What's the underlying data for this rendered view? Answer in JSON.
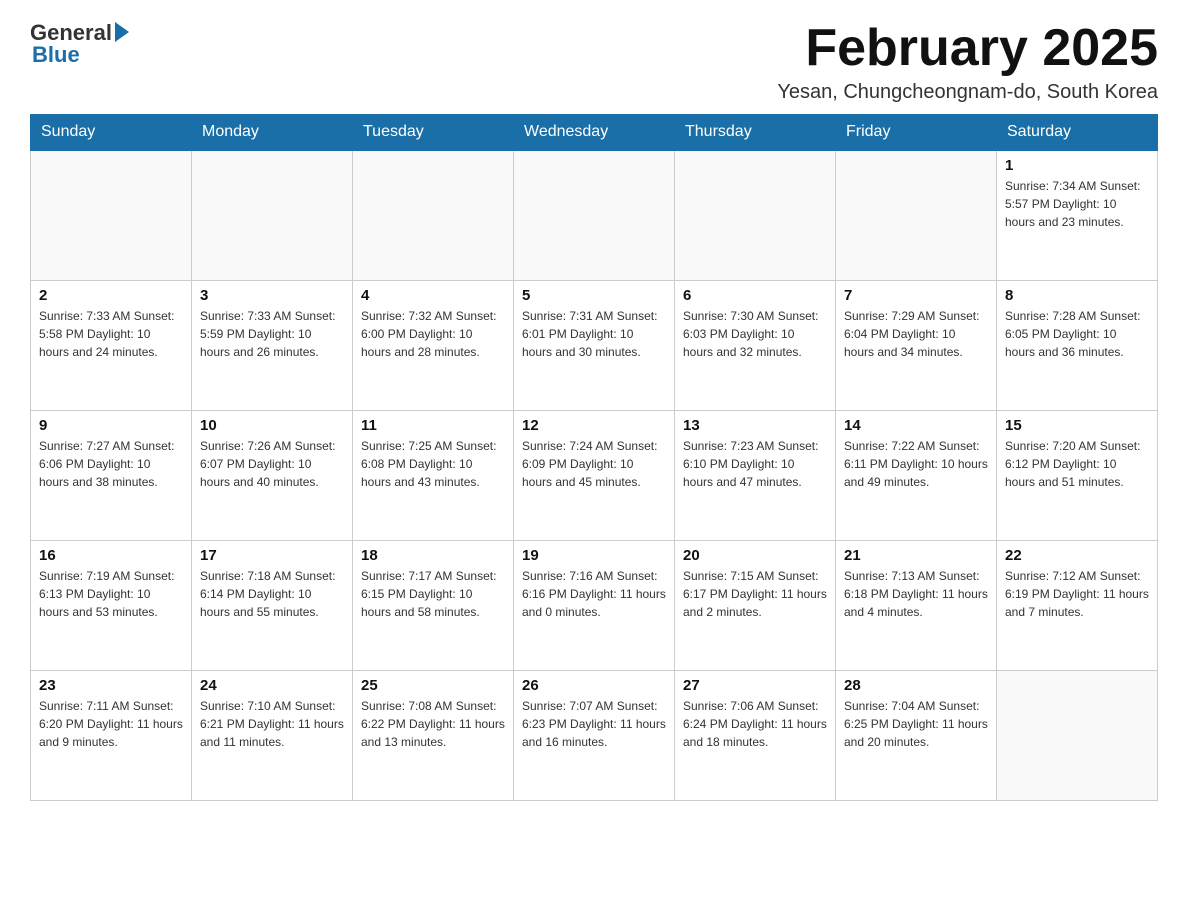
{
  "header": {
    "logo_general": "General",
    "logo_blue": "Blue",
    "month_title": "February 2025",
    "location": "Yesan, Chungcheongnam-do, South Korea"
  },
  "days_of_week": [
    "Sunday",
    "Monday",
    "Tuesday",
    "Wednesday",
    "Thursday",
    "Friday",
    "Saturday"
  ],
  "weeks": [
    [
      {
        "day": "",
        "info": ""
      },
      {
        "day": "",
        "info": ""
      },
      {
        "day": "",
        "info": ""
      },
      {
        "day": "",
        "info": ""
      },
      {
        "day": "",
        "info": ""
      },
      {
        "day": "",
        "info": ""
      },
      {
        "day": "1",
        "info": "Sunrise: 7:34 AM\nSunset: 5:57 PM\nDaylight: 10 hours and 23 minutes."
      }
    ],
    [
      {
        "day": "2",
        "info": "Sunrise: 7:33 AM\nSunset: 5:58 PM\nDaylight: 10 hours and 24 minutes."
      },
      {
        "day": "3",
        "info": "Sunrise: 7:33 AM\nSunset: 5:59 PM\nDaylight: 10 hours and 26 minutes."
      },
      {
        "day": "4",
        "info": "Sunrise: 7:32 AM\nSunset: 6:00 PM\nDaylight: 10 hours and 28 minutes."
      },
      {
        "day": "5",
        "info": "Sunrise: 7:31 AM\nSunset: 6:01 PM\nDaylight: 10 hours and 30 minutes."
      },
      {
        "day": "6",
        "info": "Sunrise: 7:30 AM\nSunset: 6:03 PM\nDaylight: 10 hours and 32 minutes."
      },
      {
        "day": "7",
        "info": "Sunrise: 7:29 AM\nSunset: 6:04 PM\nDaylight: 10 hours and 34 minutes."
      },
      {
        "day": "8",
        "info": "Sunrise: 7:28 AM\nSunset: 6:05 PM\nDaylight: 10 hours and 36 minutes."
      }
    ],
    [
      {
        "day": "9",
        "info": "Sunrise: 7:27 AM\nSunset: 6:06 PM\nDaylight: 10 hours and 38 minutes."
      },
      {
        "day": "10",
        "info": "Sunrise: 7:26 AM\nSunset: 6:07 PM\nDaylight: 10 hours and 40 minutes."
      },
      {
        "day": "11",
        "info": "Sunrise: 7:25 AM\nSunset: 6:08 PM\nDaylight: 10 hours and 43 minutes."
      },
      {
        "day": "12",
        "info": "Sunrise: 7:24 AM\nSunset: 6:09 PM\nDaylight: 10 hours and 45 minutes."
      },
      {
        "day": "13",
        "info": "Sunrise: 7:23 AM\nSunset: 6:10 PM\nDaylight: 10 hours and 47 minutes."
      },
      {
        "day": "14",
        "info": "Sunrise: 7:22 AM\nSunset: 6:11 PM\nDaylight: 10 hours and 49 minutes."
      },
      {
        "day": "15",
        "info": "Sunrise: 7:20 AM\nSunset: 6:12 PM\nDaylight: 10 hours and 51 minutes."
      }
    ],
    [
      {
        "day": "16",
        "info": "Sunrise: 7:19 AM\nSunset: 6:13 PM\nDaylight: 10 hours and 53 minutes."
      },
      {
        "day": "17",
        "info": "Sunrise: 7:18 AM\nSunset: 6:14 PM\nDaylight: 10 hours and 55 minutes."
      },
      {
        "day": "18",
        "info": "Sunrise: 7:17 AM\nSunset: 6:15 PM\nDaylight: 10 hours and 58 minutes."
      },
      {
        "day": "19",
        "info": "Sunrise: 7:16 AM\nSunset: 6:16 PM\nDaylight: 11 hours and 0 minutes."
      },
      {
        "day": "20",
        "info": "Sunrise: 7:15 AM\nSunset: 6:17 PM\nDaylight: 11 hours and 2 minutes."
      },
      {
        "day": "21",
        "info": "Sunrise: 7:13 AM\nSunset: 6:18 PM\nDaylight: 11 hours and 4 minutes."
      },
      {
        "day": "22",
        "info": "Sunrise: 7:12 AM\nSunset: 6:19 PM\nDaylight: 11 hours and 7 minutes."
      }
    ],
    [
      {
        "day": "23",
        "info": "Sunrise: 7:11 AM\nSunset: 6:20 PM\nDaylight: 11 hours and 9 minutes."
      },
      {
        "day": "24",
        "info": "Sunrise: 7:10 AM\nSunset: 6:21 PM\nDaylight: 11 hours and 11 minutes."
      },
      {
        "day": "25",
        "info": "Sunrise: 7:08 AM\nSunset: 6:22 PM\nDaylight: 11 hours and 13 minutes."
      },
      {
        "day": "26",
        "info": "Sunrise: 7:07 AM\nSunset: 6:23 PM\nDaylight: 11 hours and 16 minutes."
      },
      {
        "day": "27",
        "info": "Sunrise: 7:06 AM\nSunset: 6:24 PM\nDaylight: 11 hours and 18 minutes."
      },
      {
        "day": "28",
        "info": "Sunrise: 7:04 AM\nSunset: 6:25 PM\nDaylight: 11 hours and 20 minutes."
      },
      {
        "day": "",
        "info": ""
      }
    ]
  ]
}
